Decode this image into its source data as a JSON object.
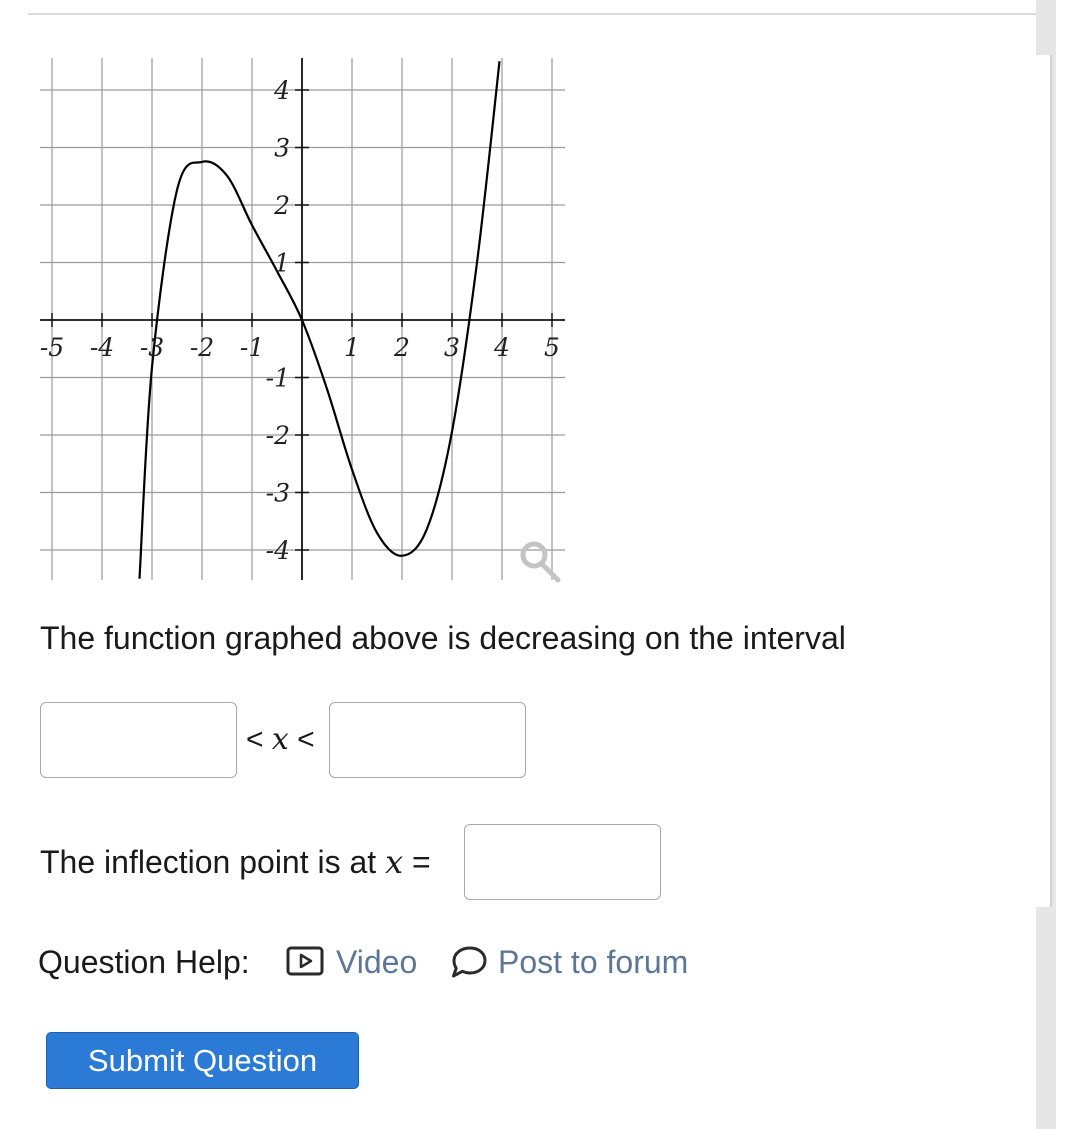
{
  "question": {
    "interval_text": "The function graphed above is decreasing on the interval",
    "inequality_op_left": "<",
    "inequality_var": "x",
    "inequality_op_right": "<",
    "inflection_text": "The inflection point is at",
    "inflection_var": "x",
    "inflection_eq": "="
  },
  "answers": {
    "lower_bound": "",
    "upper_bound": "",
    "inflection_x": ""
  },
  "help": {
    "label": "Question Help:",
    "video_label": "Video",
    "forum_label": "Post to forum"
  },
  "submit": {
    "label": "Submit Question"
  },
  "icons": {
    "video": "video-play-icon",
    "forum": "chat-bubble-icon",
    "zoom": "magnifier-icon"
  },
  "colors": {
    "link": "#5a7799",
    "button": "#2a7ad6",
    "grid": "#9a9a9a",
    "curve": "#000000"
  },
  "chart_data": {
    "type": "line",
    "x_ticks": [
      "-5",
      "-4",
      "-3",
      "-2",
      "-1",
      "1",
      "2",
      "3",
      "4",
      "5"
    ],
    "y_ticks": [
      "4",
      "3",
      "2",
      "1",
      "-1",
      "-2",
      "-3",
      "-4"
    ],
    "xlim": [
      -5,
      5
    ],
    "ylim": [
      -4.5,
      4.5
    ],
    "grid": true,
    "series": [
      {
        "x": [
          -3.25,
          -3.0,
          -2.5,
          -2.0,
          -1.5,
          -1.0,
          -0.5,
          0.0,
          0.5,
          1.0,
          1.5,
          2.0,
          2.5,
          3.0,
          3.5,
          3.95
        ],
        "y": [
          -4.5,
          -0.82,
          2.26,
          2.75,
          2.51,
          1.65,
          0.85,
          0.0,
          -1.2,
          -2.6,
          -3.7,
          -4.1,
          -3.63,
          -1.94,
          1.0,
          4.5
        ]
      }
    ]
  }
}
